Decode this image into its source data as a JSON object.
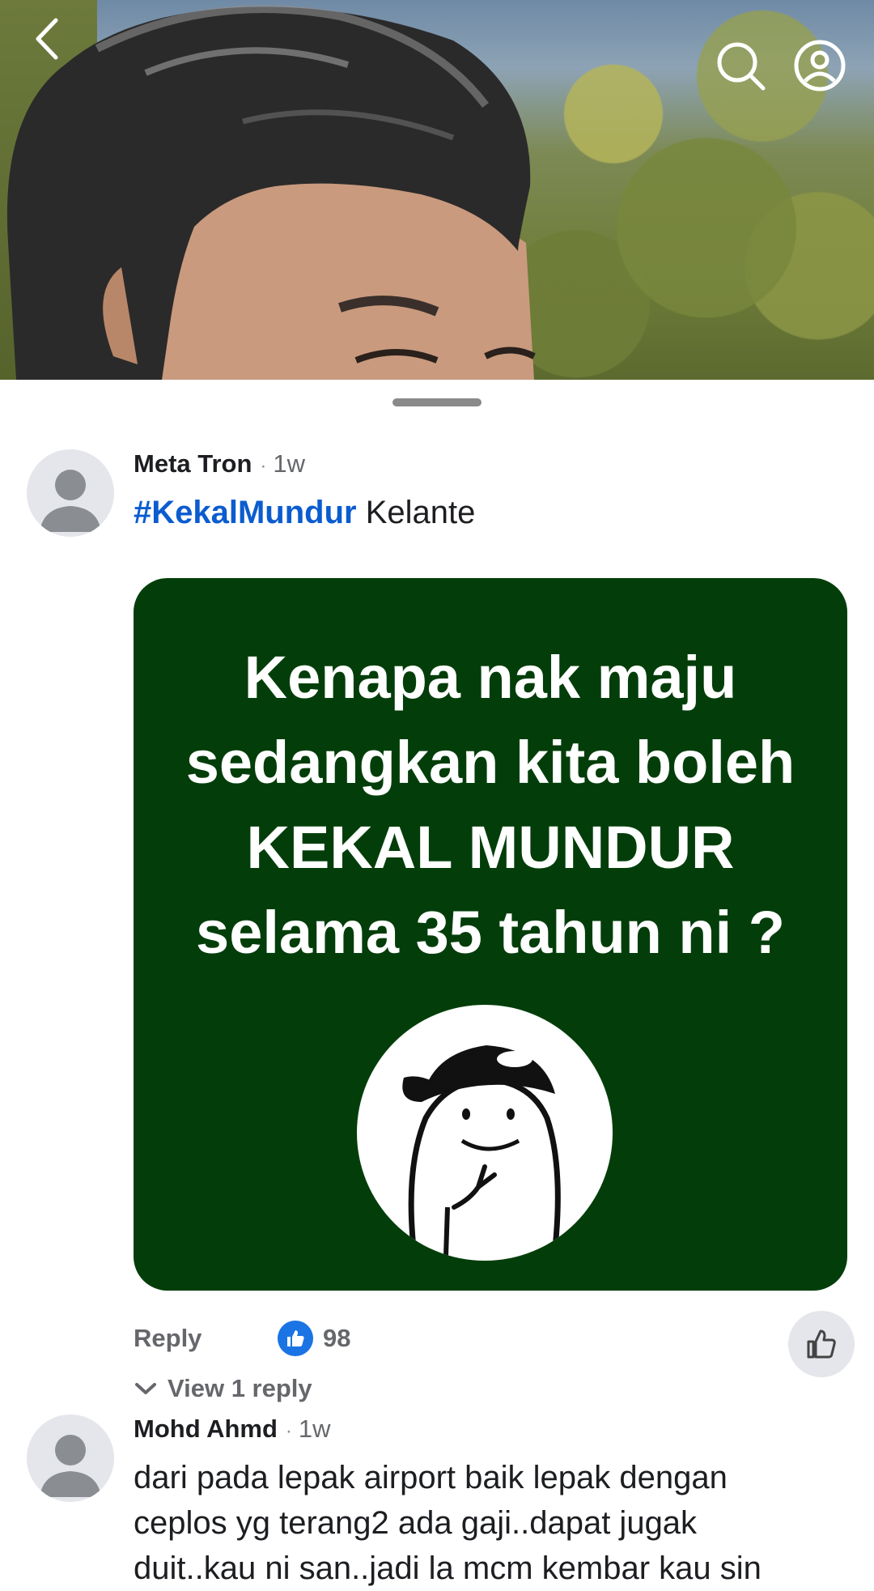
{
  "comments": [
    {
      "author": "Meta Tron",
      "separator": "·",
      "time": "1w",
      "hashtag": "#KekalMundur",
      "text": "Kelante",
      "image": {
        "lines": [
          "Kenapa nak maju",
          "sedangkan kita boleh",
          "KEKAL MUNDUR",
          "selama 35 tahun ni ?"
        ],
        "background": "#033e0a"
      },
      "reply_label": "Reply",
      "like_count": "98",
      "view_replies_label": "View 1 reply"
    },
    {
      "author": "Mohd Ahmd",
      "separator": "·",
      "time": "1w",
      "text_lines": [
        "dari pada lepak airport baik lepak dengan",
        "ceplos yg terang2 ada gaji..dapat jugak",
        "duit..kau ni san..jadi la mcm kembar kau sin"
      ]
    }
  ],
  "icons": {
    "back": "chevron-left-icon",
    "search": "search-icon",
    "account": "account-circle-icon",
    "like_reaction": "thumbs-up-icon",
    "like_button": "thumbs-up-outline-icon",
    "expand": "chevron-down-icon"
  },
  "colors": {
    "link_blue": "#0b5ccf",
    "reaction_blue": "#1b74e4",
    "secondary_text": "#65676b"
  }
}
